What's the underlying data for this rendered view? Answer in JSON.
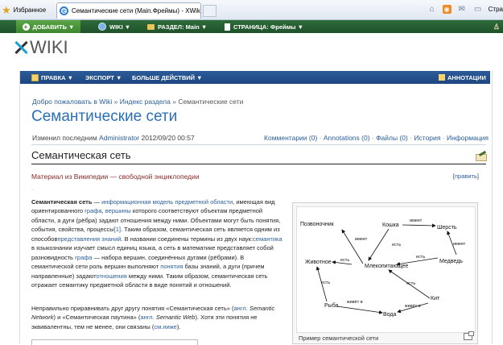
{
  "browser": {
    "favorites_label": "Избранное",
    "tab_title": "Семантические сети (Main.Фреймы) - XWiki",
    "page_menu_label": "Стра"
  },
  "topbar": {
    "add": "ДОБАВИТЬ ▼",
    "wiki": "WIKI ▼",
    "section": "РАЗДЕЛ: Main ▼",
    "page": "СТРАНИЦА: Фреймы ▼"
  },
  "logo": {
    "text": "WIKI"
  },
  "menubar": {
    "edit": "ПРАВКА ▼",
    "export": "ЭКСПОРТ ▼",
    "more": "БОЛЬШЕ ДЕЙСТВИЙ ▼",
    "annotations": "АННОТАЦИИ"
  },
  "breadcrumb": {
    "home": "Добро пожаловать в Wiki",
    "index": "Индекс раздела",
    "current": "Семантические сети",
    "separator": "»"
  },
  "page_title": "Семантические сети",
  "meta": {
    "prefix": "Изменил последним",
    "author": "Administrator",
    "date": "2012/09/20 00:57"
  },
  "meta_links": {
    "comments": "Комментарии (0)",
    "annotations": "Annotations (0)",
    "files": "Файлы (0)",
    "history": "История",
    "info": "Информация",
    "sep": " · "
  },
  "heading": "Семантическая сеть",
  "subtitle": "Материал из Википедии — свободной энциклопедии",
  "edit_link": {
    "open": "[",
    "label": "править",
    "close": "]"
  },
  "dot": ".",
  "para1": {
    "term": "Семантическая сеть",
    "t1": " — ",
    "l1": "информационная",
    "t2": " ",
    "l2": "модель предметной области",
    "t3": ", имеющая вид ориентированного ",
    "l3": "графа",
    "t4": ", ",
    "l4": "вершины",
    "t5": " которого соответствуют объектам предметной области, а дуги (рёбра) задают отношения между ними. Объектами могут быть понятия, события, свойства, процессы",
    "l5": "[1]",
    "t6": ". Таким образом, семантическая сеть является одним из способов",
    "l6": "представления знаний",
    "t7": ". В названии соединены термины из двух наук:",
    "l7": "семантика",
    "t8": " в языкознании изучает смысл единиц языка, а сеть в математике представляет собой разновидность ",
    "l8": "графа",
    "t9": " — набора вершин, соединённых дугами (рёбрами). В семантической сети роль вершин выполняют ",
    "l9": "понятия",
    "t10": " базы знаний, а дуги (причем направленные) задают",
    "l10": "отношения",
    "t11": " между ними. Таким образом, семантическая сеть отражает семантику предметной области в виде понятий и отношений."
  },
  "para2": {
    "t1": "Неправильно приравнивать друг другу понятия «Семантическая сеть» (",
    "l1": "англ.",
    "t2": " ",
    "i1": "Semantic Network",
    "t3": ") и «Семантическая паутина» (",
    "l2": "англ.",
    "t4": " ",
    "i2": "Semantic Web",
    "t5": "). Хотя эти понятия не эквивалентны, тем не менее, они связаны (",
    "l3": "см.ниже",
    "t6": ")."
  },
  "figure": {
    "caption": "Пример семантической сети",
    "nodes": {
      "pozv": "Позвоночник",
      "koshka": "Кошка",
      "sherst": "Шерсть",
      "zhivotnoe": "Животное",
      "mlek": "Млекопитающее",
      "medved": "Медведь",
      "kit": "Кит",
      "ryba": "Рыба",
      "voda": "Вода"
    },
    "edges": {
      "imeet": "имеет",
      "est": "есть",
      "zhivet_v": "живёт в"
    }
  }
}
